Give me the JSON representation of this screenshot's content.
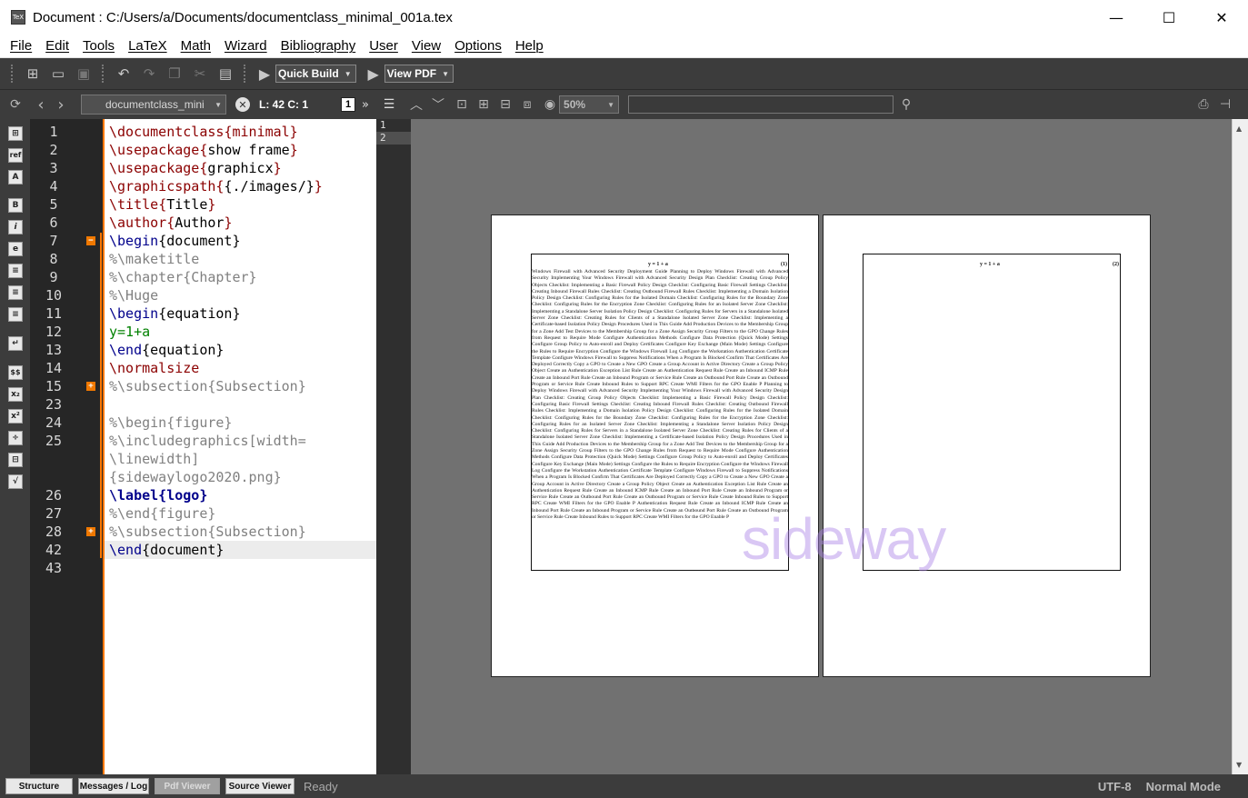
{
  "window": {
    "title": "Document : C:/Users/a/Documents/documentclass_minimal_001a.tex",
    "icon_text": "TeX"
  },
  "menu": [
    "File",
    "Edit",
    "Tools",
    "LaTeX",
    "Math",
    "Wizard",
    "Bibliography",
    "User",
    "View",
    "Options",
    "Help"
  ],
  "toolbar": {
    "build_label": "Quick Build",
    "view_label": "View PDF"
  },
  "toolbar2": {
    "document_name": "documentclass_mini",
    "cursor_position": "L: 42 C: 1",
    "page_number": "1",
    "zoom": "50%",
    "search_value": ""
  },
  "side_icons": [
    "insert-icon",
    "ref-icon",
    "font-A-icon",
    "bold-B-icon",
    "italic-i-icon",
    "emph-e-icon",
    "list-icon",
    "list2-icon",
    "list3-icon",
    "newline-icon",
    "math-dollar-icon",
    "subscript-icon",
    "superscript-icon",
    "frac-icon",
    "dfrac-icon",
    "sqrt-icon"
  ],
  "side_icon_glyphs": [
    "⊞",
    "ref",
    "A",
    "B",
    "i",
    "e",
    "≡",
    "≡",
    "≡",
    "↵",
    "$$",
    "x₂",
    "x²",
    "÷",
    "⊟",
    "√"
  ],
  "editor": {
    "line_numbers": [
      "1",
      "2",
      "3",
      "4",
      "5",
      "6",
      "7",
      "8",
      "9",
      "10",
      "11",
      "12",
      "13",
      "14",
      "15",
      "23",
      "24",
      "25",
      "",
      "",
      "26",
      "27",
      "28",
      "42",
      "43"
    ]
  },
  "structure_items": [
    "1",
    "2"
  ],
  "pdf": {
    "page1_equation": "y = 1 + a",
    "page1_eqnum": "(1)",
    "page2_equation": "y = 1 + a",
    "page2_eqnum": "(2)",
    "page1_text": "Windows Firewall with Advanced Security Deployment Guide Planning to Deploy Windows Firewall with Advanced Security Implementing Your Windows Firewall with Advanced Security Design Plan Checklist: Creating Group Policy Objects Checklist: Implementing a Basic Firewall Policy Design Checklist: Configuring Basic Firewall Settings Checklist: Creating Inbound Firewall Rules Checklist: Creating Outbound Firewall Rules Checklist: Implementing a Domain Isolation Policy Design Checklist: Configuring Rules for the Isolated Domain Checklist: Configuring Rules for the Boundary Zone Checklist: Configuring Rules for the Encryption Zone Checklist: Configuring Rules for an Isolated Server Zone Checklist: Implementing a Standalone Server Isolation Policy Design Checklist: Configuring Rules for Servers in a Standalone Isolated Server Zone Checklist: Creating Rules for Clients of a Standalone Isolated Server Zone Checklist: Implementing a Certificate-based Isolation Policy Design Procedures Used in This Guide Add Production Devices to the Membership Group for a Zone Add Test Devices to the Membership Group for a Zone Assign Security Group Filters to the GPO Change Rules from Request to Require Mode Configure Authentication Methods Configure Data Protection (Quick Mode) Settings Configure Group Policy to Auto-enroll and Deploy Certificates Configure Key Exchange (Main Mode) Settings Configure the Rules to Require Encryption Configure the Windows Firewall Log Configure the Workstation Authentication Certificate Template Configure Windows Firewall to Suppress Notifications When a Program Is Blocked Confirm That Certificates Are Deployed Correctly Copy a GPO to Create a New GPO Create a Group Account in Active Directory Create a Group Policy Object Create an Authentication Exception List Rule Create an Authentication Request Rule Create an Inbound ICMP Rule Create an Inbound Port Rule Create an Inbound Program or Service Rule Create an Outbound Port Rule Create an Outbound Program or Service Rule Create Inbound Rules to Support RPC Create WMI Filters for the GPO Enable P Planning to Deploy Windows Firewall with Advanced Security Implementing Your Windows Firewall with Advanced Security Design Plan Checklist: Creating Group Policy Objects Checklist: Implementing a Basic Firewall Policy Design Checklist: Configuring Basic Firewall Settings Checklist: Creating Inbound Firewall Rules Checklist: Creating Outbound Firewall Rules Checklist: Implementing a Domain Isolation Policy Design Checklist: Configuring Rules for the Isolated Domain Checklist: Configuring Rules for the Boundary Zone Checklist: Configuring Rules for the Encryption Zone Checklist: Configuring Rules for an Isolated Server Zone Checklist: Implementing a Standalone Server Isolation Policy Design Checklist: Configuring Rules for Servers in a Standalone Isolated Server Zone Checklist: Creating Rules for Clients of a Standalone Isolated Server Zone Checklist: Implementing a Certificate-based Isolation Policy Design Procedures Used in This Guide Add Production Devices to the Membership Group for a Zone Add Test Devices to the Membership Group for a Zone Assign Security Group Filters to the GPO Change Rules from Request to Require Mode Configure Authentication Methods Configure Data Protection (Quick Mode) Settings Configure Group Policy to Auto-enroll and Deploy Certificates Configure Key Exchange (Main Mode) Settings Configure the Rules to Require Encryption Configure the Windows Firewall Log Configure the Workstation Authentication Certificate Template Configure Windows Firewall to Suppress Notifications When a Program Is Blocked Confirm That Certificates Are Deployed Correctly Copy a GPO to Create a New GPO Create a Group Account in Active Directory Create a Group Policy Object Create an Authentication Exception List Rule Create an Authentication Request Rule Create an Inbound ICMP Rule Create an Inbound Port Rule Create an Inbound Program or Service Rule Create an Outbound Port Rule Create an Outbound Program or Service Rule Create Inbound Rules to Support RPC Create WMI Filters for the GPO Enable P Authentication Request Rule Create an Inbound ICMP Rule Create an Inbound Port Rule Create an Inbound Program or Service Rule Create an Outbound Port Rule Create an Outbound Program or Service Rule Create Inbound Rules to Support RPC Create WMI Filters for the GPO Enable P",
    "watermark": "sideway"
  },
  "statusbar": {
    "tabs": [
      "Structure",
      "Messages / Log",
      "Pdf Viewer",
      "Source Viewer"
    ],
    "active_tab": "Pdf Viewer",
    "status": "Ready",
    "encoding": "UTF-8",
    "mode": "Normal Mode"
  }
}
